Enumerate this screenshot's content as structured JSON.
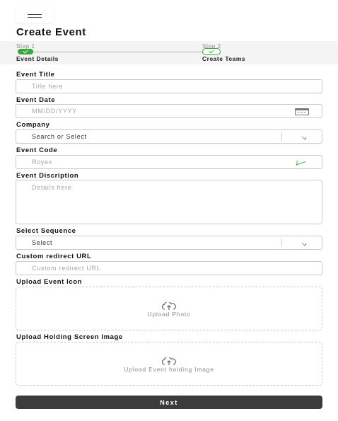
{
  "header": {
    "menu_icon": "hamburger-icon",
    "title": "Create Event"
  },
  "stepper": {
    "steps": [
      {
        "number": "Step 1",
        "label": "Event Details",
        "status": "completed"
      },
      {
        "number": "Step 2",
        "label": "Create Teams",
        "status": "upcoming"
      }
    ],
    "accent_color": "#3aa83a"
  },
  "form": {
    "event_title": {
      "label": "Event Title",
      "placeholder": "Title here"
    },
    "event_date": {
      "label": "Event Date",
      "placeholder": "MM/DD/YYYY",
      "icon": "calendar-icon"
    },
    "company": {
      "label": "Company",
      "value": "Search or Select",
      "icon": "chevron-down-icon"
    },
    "event_code": {
      "label": "Event Code",
      "placeholder": "Royex",
      "icon": "check-icon"
    },
    "event_description": {
      "label": "Event Discription",
      "placeholder": "Details here"
    },
    "select_sequence": {
      "label": "Select Sequence",
      "value": "Select",
      "icon": "chevron-down-icon"
    },
    "custom_redirect_url": {
      "label": "Custom redirect URL",
      "placeholder": "Custom redirect URL"
    },
    "upload_event_icon": {
      "label": "Upload Event Icon",
      "button_text": "Upload Photo",
      "icon": "cloud-upload-icon"
    },
    "upload_holding_image": {
      "label": "Upload Holding Screen Image",
      "button_text": "Upload Event holding Image",
      "icon": "cloud-upload-icon"
    }
  },
  "actions": {
    "next_label": "Next",
    "next_color": "#3c3c3c"
  }
}
